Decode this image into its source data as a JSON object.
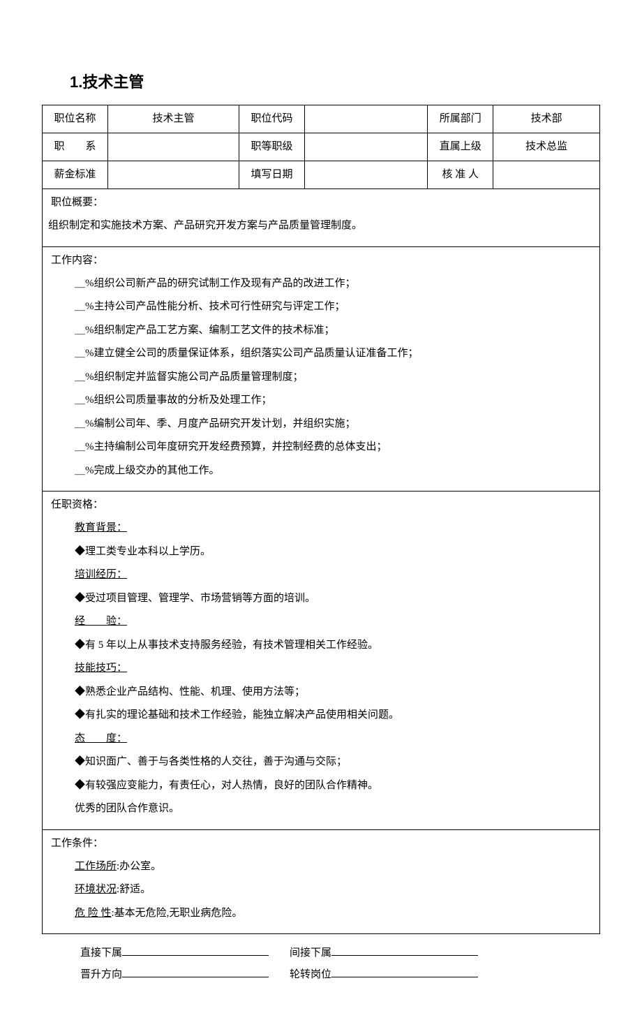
{
  "title": "1.技术主管",
  "header": {
    "row1": {
      "label1": "职位名称",
      "value1": "技术主管",
      "label2": "职位代码",
      "value2": "",
      "label3": "所属部门",
      "value3": "技术部"
    },
    "row2": {
      "label1": "职　　系",
      "value1": "",
      "label2": "职等职级",
      "value2": "",
      "label3": "直属上级",
      "value3": "技术总监"
    },
    "row3": {
      "label1": "薪金标准",
      "value1": "",
      "label2": "填写日期",
      "value2": "",
      "label3": "核 准 人",
      "value3": ""
    }
  },
  "summary": {
    "title": "职位概要：",
    "text": "组织制定和实施技术方案、产品研究开发方案与产品质量管理制度。"
  },
  "work": {
    "title": "工作内容：",
    "items": [
      "＿%组织公司新产品的研究试制工作及现有产品的改进工作；",
      "＿%主持公司产品性能分析、技术可行性研究与评定工作；",
      "＿%组织制定产品工艺方案、编制工艺文件的技术标准；",
      "＿%建立健全公司的质量保证体系，组织落实公司产品质量认证准备工作；",
      "＿%组织制定并监督实施公司产品质量管理制度；",
      "＿%组织公司质量事故的分析及处理工作；",
      "＿%编制公司年、季、月度产品研究开发计划，并组织实施；",
      "＿%主持编制公司年度研究开发经费预算，并控制经费的总体支出；",
      "＿%完成上级交办的其他工作。"
    ]
  },
  "qualification": {
    "title": "任职资格：",
    "edu_title": "教育背景：",
    "edu_text": "◆理工类专业本科以上学历。",
    "train_title": "培训经历：",
    "train_text": "◆受过项目管理、管理学、市场营销等方面的培训。",
    "exp_title": "经　　验：",
    "exp_text": "◆有 5 年以上从事技术支持服务经验，有技术管理相关工作经验。",
    "skill_title": "技能技巧：",
    "skill_text1": "◆熟悉企业产品结构、性能、机理、使用方法等；",
    "skill_text2": "◆有扎实的理论基础和技术工作经验，能独立解决产品使用相关问题。",
    "att_title": "态　　度：",
    "att_text1": "◆知识面广、善于与各类性格的人交往，善于沟通与交际；",
    "att_text2": "◆有较强应变能力，有责任心，对人热情，良好的团队合作精神。",
    "att_text3": "优秀的团队合作意识。"
  },
  "conditions": {
    "title": "工作条件：",
    "place_label": "工作场所",
    "place_text": ":办公室。",
    "env_label": "环境状况",
    "env_text": ":舒适。",
    "danger_label": "危 险 性",
    "danger_text": ":基本无危险,无职业病危险。"
  },
  "footer": {
    "direct_sub": "直接下属",
    "indirect_sub": "间接下属",
    "promotion": "晋升方向",
    "rotation": "轮转岗位"
  }
}
